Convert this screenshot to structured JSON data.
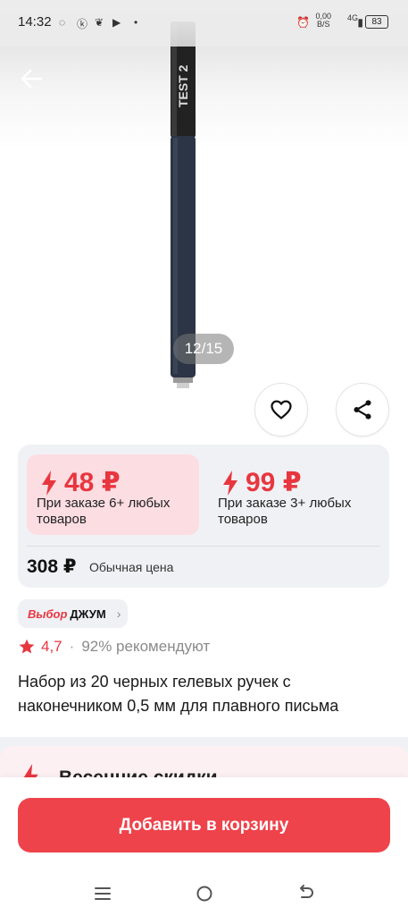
{
  "status_bar": {
    "time": "14:32",
    "net_speed_value": "0,00",
    "net_speed_unit": "B/S",
    "network": "4G",
    "battery": "83"
  },
  "gallery": {
    "counter": "12/15",
    "pen_print": "TEST 2",
    "accent_color": "#e8363f"
  },
  "price": {
    "tiers": [
      {
        "value": "48 ₽",
        "desc_line1": "При заказе 6+ любых",
        "desc_line2": "товаров",
        "selected": true
      },
      {
        "value": "99 ₽",
        "desc_line1": "При заказе 3+ любых",
        "desc_line2": "товаров",
        "selected": false
      }
    ],
    "regular_value": "308 ₽",
    "regular_label": "Обычная цена"
  },
  "badge": {
    "brand": "Выбор",
    "name": "ДЖУМ"
  },
  "rating": {
    "value": "4,7",
    "separator": "·",
    "recommend": "92% рекомендуют"
  },
  "product": {
    "title": "Набор из 20 черных гелевых ручек с наконечником 0,5 мм для плавного письма"
  },
  "promo": {
    "title": "Весенние скидки"
  },
  "cart": {
    "label": "Добавить в корзину"
  }
}
